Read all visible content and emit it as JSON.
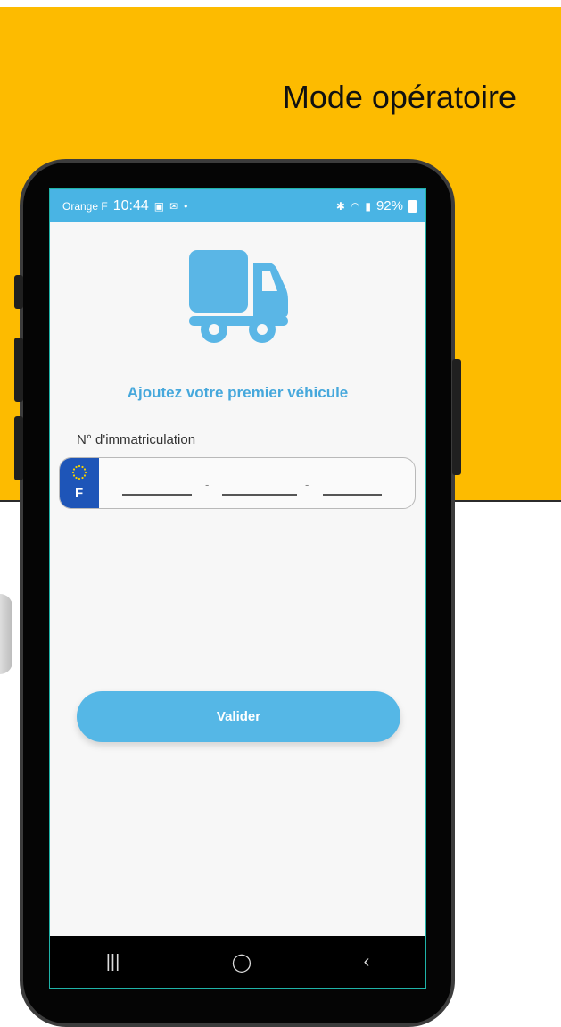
{
  "page": {
    "title": "Mode opératoire"
  },
  "status_bar": {
    "carrier": "Orange F",
    "time": "10:44",
    "battery": "92%"
  },
  "screen": {
    "heading": "Ajoutez votre premier véhicule",
    "registration_label": "N° d'immatriculation",
    "plate": {
      "country_code": "F",
      "separator": "-"
    },
    "submit_label": "Valider"
  },
  "nav_bar": {
    "recents": "|||",
    "home": "◯",
    "back": "‹"
  },
  "colors": {
    "accent": "#55b7e6",
    "banner": "#fdbb00",
    "eu_blue": "#1e55b8"
  }
}
